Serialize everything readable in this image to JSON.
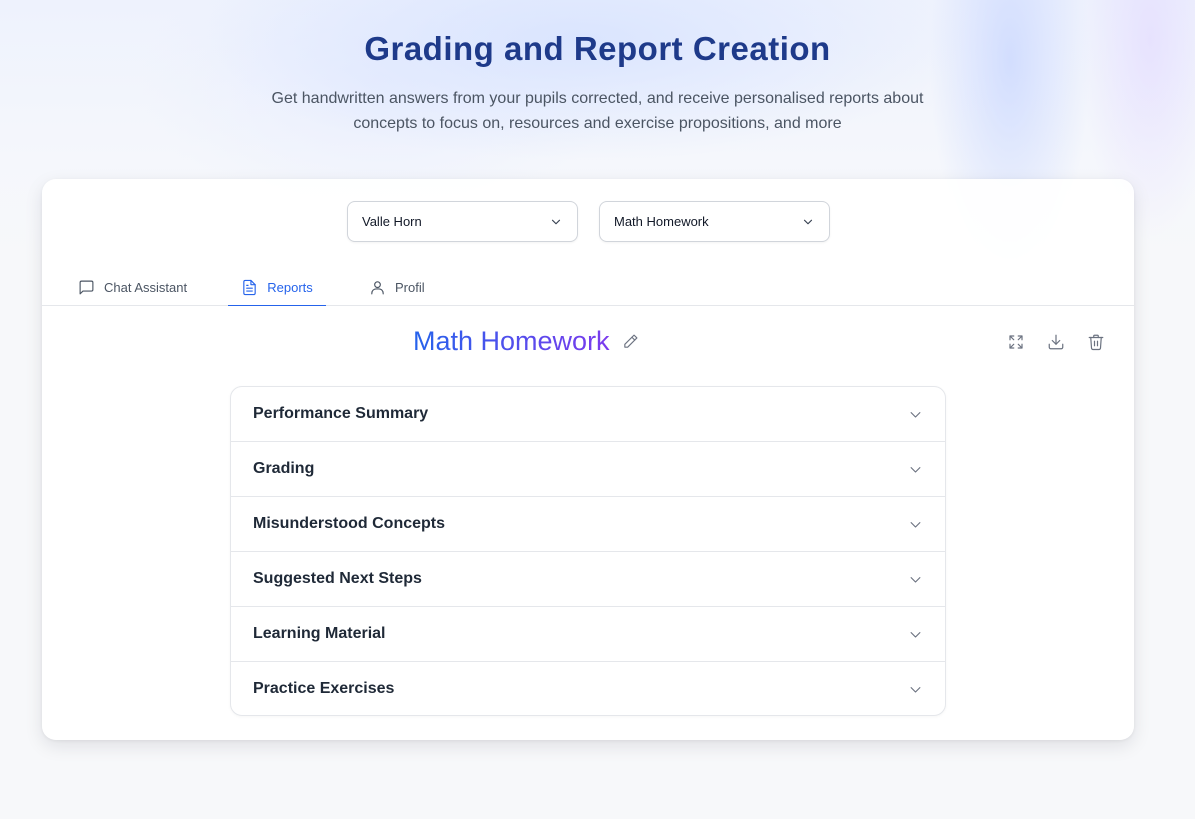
{
  "header": {
    "title": "Grading and Report Creation",
    "subtitle": "Get handwritten answers from your pupils corrected, and receive personalised reports about concepts to focus on, resources and exercise propositions, and more"
  },
  "selectors": {
    "student": "Valle Horn",
    "assignment": "Math Homework"
  },
  "tabs": [
    {
      "label": "Chat Assistant",
      "icon": "chat-bubble-icon",
      "active": false
    },
    {
      "label": "Reports",
      "icon": "document-icon",
      "active": true
    },
    {
      "label": "Profil",
      "icon": "user-icon",
      "active": false
    }
  ],
  "report": {
    "title": "Math Homework",
    "actions": [
      "expand-icon",
      "download-icon",
      "trash-icon"
    ]
  },
  "sections": [
    {
      "label": "Performance Summary"
    },
    {
      "label": "Grading"
    },
    {
      "label": "Misunderstood Concepts"
    },
    {
      "label": "Suggested Next Steps"
    },
    {
      "label": "Learning Material"
    },
    {
      "label": "Practice Exercises"
    }
  ],
  "colors": {
    "title": "#1e3a8a",
    "accent": "#2563eb",
    "gradient_end": "#7c3aed"
  }
}
